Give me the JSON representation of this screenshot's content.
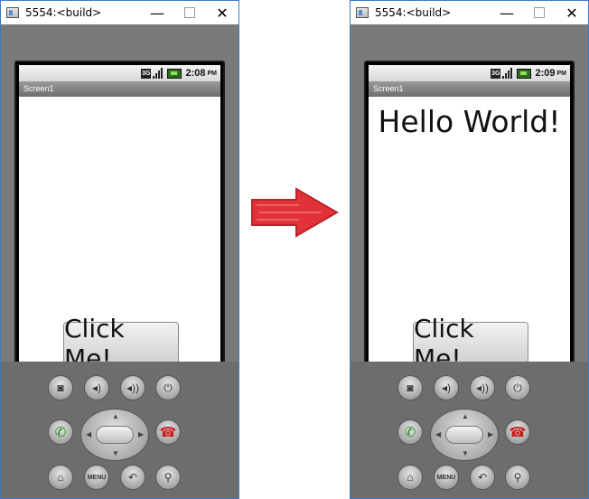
{
  "windows": [
    {
      "title": "5554:<build>",
      "controls": {
        "minimize": "—",
        "maximize": "☐",
        "close": "✕"
      },
      "status_bar": {
        "network": "3G",
        "time": "2:08",
        "ampm": "PM"
      },
      "app_title": "Screen1",
      "screen": {
        "label": "",
        "button": "Click Me!"
      }
    },
    {
      "title": "5554:<build>",
      "controls": {
        "minimize": "—",
        "maximize": "☐",
        "close": "✕"
      },
      "status_bar": {
        "network": "3G",
        "time": "2:09",
        "ampm": "PM"
      },
      "app_title": "Screen1",
      "screen": {
        "label": "Hello World!",
        "button": "Click Me!"
      }
    }
  ],
  "phone_controls": {
    "menu_label": "MENU",
    "icons": [
      "camera-icon",
      "volume-down-icon",
      "volume-up-icon",
      "power-icon",
      "call-icon",
      "dpad",
      "end-call-icon",
      "home-icon",
      "menu-button",
      "back-icon",
      "search-icon"
    ]
  },
  "arrow": {
    "color": "#e02028",
    "direction": "right"
  }
}
